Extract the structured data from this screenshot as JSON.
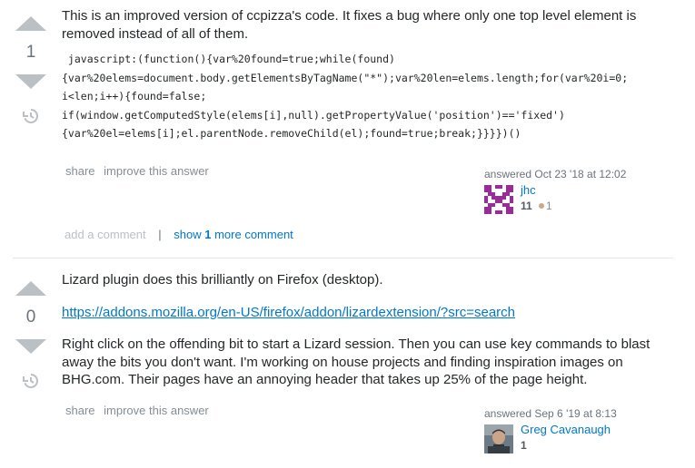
{
  "answers": [
    {
      "votes": "1",
      "text": "This is an improved version of ccpizza's code. It fixes a bug where only one top level element is removed instead of all of them.",
      "code_lines": [
        " javascript:(function(){var%20found=true;while(found)",
        "{var%20elems=document.body.getElementsByTagName(\"*\");var%20len=elems.length;for(var%20i=0;",
        "i<len;i++){found=false;",
        "if(window.getComputedStyle(elems[i],null).getPropertyValue('position')=='fixed')",
        "{var%20el=elems[i];el.parentNode.removeChild(el);found=true;break;}}}})()"
      ],
      "menu": {
        "share": "share",
        "improve": "improve this answer"
      },
      "answered_label": "answered",
      "answered_time": "Oct 23 '18 at 12:02",
      "user": {
        "name": "jhc",
        "reputation": "11",
        "bronze_badges": "1"
      },
      "comments": {
        "add": "add a comment",
        "separator": "|",
        "show": "show",
        "count": "1",
        "more": "more comment"
      }
    },
    {
      "votes": "0",
      "paragraph1": "Lizard plugin does this brilliantly on Firefox (desktop).",
      "link": "https://addons.mozilla.org/en-US/firefox/addon/lizardextension/?src=search",
      "paragraph2": "Right click on the offending bit to start a Lizard session. Then you can use key commands to blast away the bits you don't want. I'm working on house projects and finding inspiration images on BHG.com. Their pages have an annoying header that takes up 25% of the page height.",
      "menu": {
        "share": "share",
        "improve": "improve this answer"
      },
      "answered_label": "answered",
      "answered_time": "Sep 6 '19 at 8:13",
      "user": {
        "name": "Greg Cavanaugh",
        "reputation": "1"
      }
    }
  ],
  "icons": {
    "upvote": "upvote-arrow-icon",
    "downvote": "downvote-arrow-icon",
    "history": "history-icon"
  },
  "colors": {
    "link": "#0077cc",
    "vote_arrow": "#bbc0c4",
    "identicon": "#9b2b9b",
    "bronze": "#d1a684"
  }
}
